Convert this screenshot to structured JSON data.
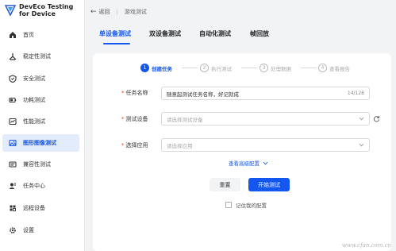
{
  "app": {
    "title_line1": "DevEco Testing",
    "title_line2": "for Device"
  },
  "sidebar": {
    "items": [
      {
        "label": "首页",
        "icon": "home-icon",
        "active": false
      },
      {
        "label": "稳定性测试",
        "icon": "stability-icon",
        "active": false
      },
      {
        "label": "安全测试",
        "icon": "shield-icon",
        "active": false
      },
      {
        "label": "功耗测试",
        "icon": "power-icon",
        "active": false
      },
      {
        "label": "性能测试",
        "icon": "performance-icon",
        "active": false
      },
      {
        "label": "图形图像测试",
        "icon": "image-icon",
        "active": true
      },
      {
        "label": "兼容性测试",
        "icon": "compatibility-icon",
        "active": false
      },
      {
        "label": "任务中心",
        "icon": "task-icon",
        "active": false
      },
      {
        "label": "远程设备",
        "icon": "remote-device-icon",
        "active": false
      },
      {
        "label": "设置",
        "icon": "gear-icon",
        "active": false
      }
    ]
  },
  "topbar": {
    "back_label": "返回",
    "breadcrumb": "游戏测试"
  },
  "tabs": [
    {
      "label": "单设备测试",
      "active": true
    },
    {
      "label": "双设备测试",
      "active": false
    },
    {
      "label": "自动化测试",
      "active": false
    },
    {
      "label": "帧回放",
      "active": false
    }
  ],
  "steps": [
    {
      "num": "1",
      "label": "创建任务",
      "current": true
    },
    {
      "num": "2",
      "label": "执行测试",
      "current": false
    },
    {
      "num": "3",
      "label": "处理数据",
      "current": false
    },
    {
      "num": "4",
      "label": "查看报告",
      "current": false
    }
  ],
  "form": {
    "task_name": {
      "label": "任务名称",
      "value": "随意起测试任务名称，好记就成",
      "count": "14/128"
    },
    "device": {
      "label": "测试设备",
      "placeholder": "请选择测试设备"
    },
    "app": {
      "label": "选择应用",
      "placeholder": "请选择应用"
    },
    "advanced_label": "查看高级配置",
    "reset_label": "重置",
    "start_label": "开始测试",
    "remember_label": "记住我的配置",
    "remember_checked": false
  },
  "watermark": "www.cfan.com.cn",
  "colors": {
    "accent": "#1456f0",
    "active_bg": "#e3ecfc",
    "required": "#e84026"
  }
}
